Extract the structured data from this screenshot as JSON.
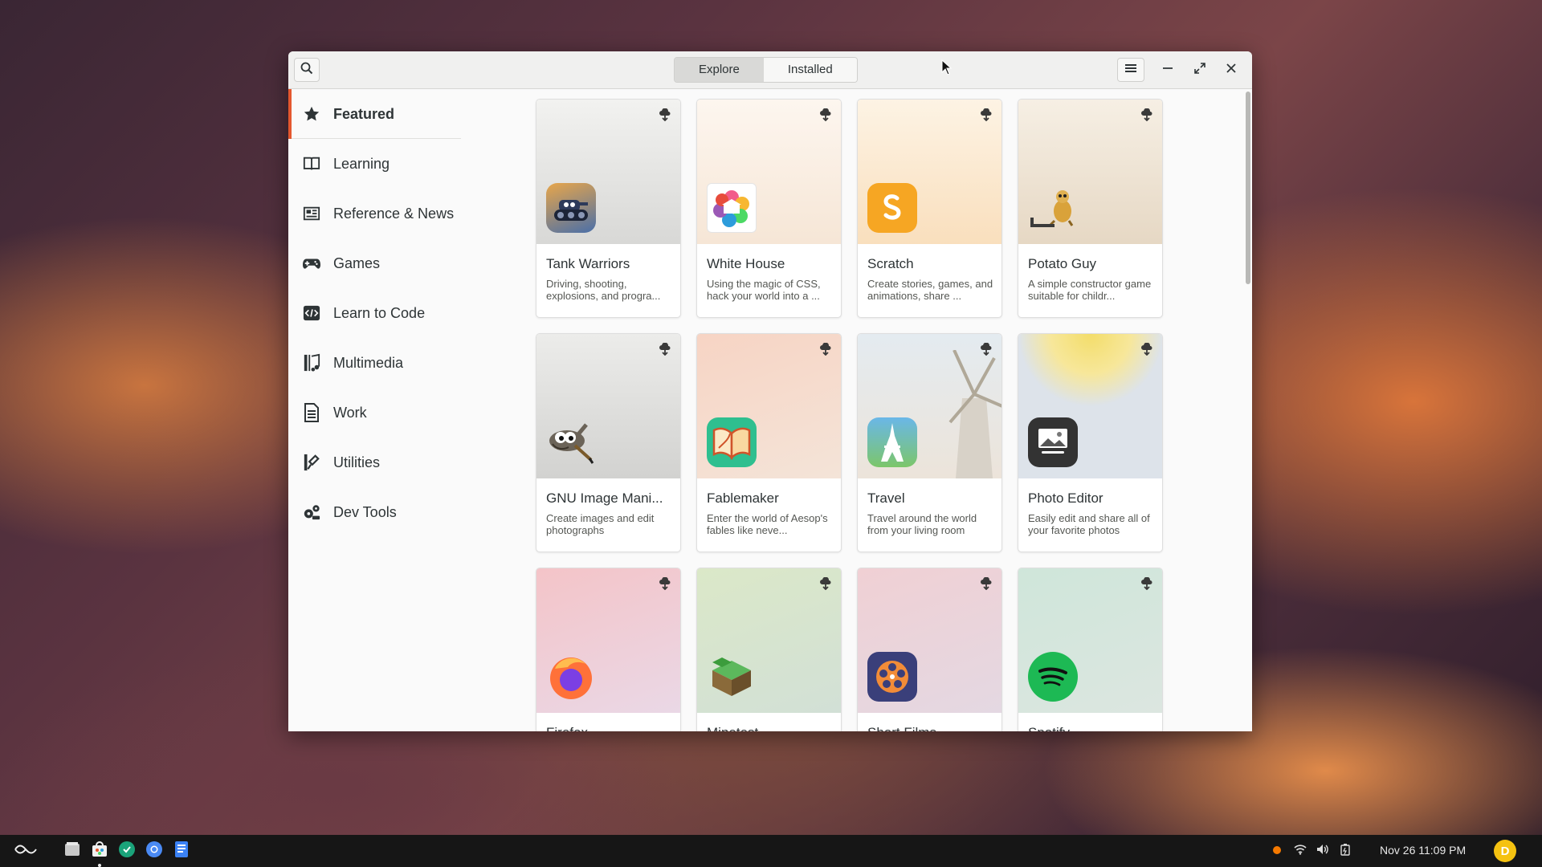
{
  "header": {
    "tabs": [
      {
        "label": "Explore",
        "active": true
      },
      {
        "label": "Installed",
        "active": false
      }
    ],
    "search_icon": "search-icon",
    "menu_icon": "hamburger-menu-icon"
  },
  "sidebar": {
    "items": [
      {
        "label": "Featured",
        "icon": "star-icon",
        "active": true
      },
      {
        "label": "Learning",
        "icon": "book-icon"
      },
      {
        "label": "Reference & News",
        "icon": "newspaper-icon"
      },
      {
        "label": "Games",
        "icon": "gamepad-icon"
      },
      {
        "label": "Learn to Code",
        "icon": "code-icon"
      },
      {
        "label": "Multimedia",
        "icon": "music-icon"
      },
      {
        "label": "Work",
        "icon": "document-icon"
      },
      {
        "label": "Utilities",
        "icon": "tools-icon"
      },
      {
        "label": "Dev Tools",
        "icon": "gears-icon"
      }
    ]
  },
  "apps": [
    {
      "title": "Tank Warriors",
      "desc": "Driving, shooting, explosions, and progra...",
      "icon": "tank-icon"
    },
    {
      "title": "White House",
      "desc": "Using the magic of CSS, hack your world into a ...",
      "icon": "white-house-icon"
    },
    {
      "title": "Scratch",
      "desc": "Create stories, games, and animations, share ...",
      "icon": "scratch-icon"
    },
    {
      "title": "Potato Guy",
      "desc": "A simple constructor game suitable for childr...",
      "icon": "potato-guy-icon"
    },
    {
      "title": "GNU Image Mani...",
      "desc": "Create images and edit photographs",
      "icon": "gimp-icon"
    },
    {
      "title": "Fablemaker",
      "desc": "Enter the world of Aesop's fables like neve...",
      "icon": "fablemaker-icon"
    },
    {
      "title": "Travel",
      "desc": "Travel around the world from your living room",
      "icon": "eiffel-tower-icon"
    },
    {
      "title": "Photo Editor",
      "desc": "Easily edit and share all of your favorite photos",
      "icon": "photo-editor-icon"
    },
    {
      "title": "Firefox",
      "desc": "",
      "icon": "firefox-icon"
    },
    {
      "title": "Minetest",
      "desc": "",
      "icon": "minetest-icon"
    },
    {
      "title": "Short Films",
      "desc": "",
      "icon": "film-reel-icon"
    },
    {
      "title": "Spotify",
      "desc": "",
      "icon": "spotify-icon"
    }
  ],
  "taskbar": {
    "clock": "Nov 26  11:09 PM",
    "avatar_letter": "D",
    "tray_icons": [
      "notification-dot-icon",
      "wifi-icon",
      "volume-icon",
      "battery-icon"
    ],
    "pinned_apps": [
      "files-icon",
      "app-center-icon",
      "app-icon",
      "chromium-icon",
      "document-app-icon"
    ]
  },
  "colors": {
    "accent": "#e4572e",
    "spotify": "#1db954"
  }
}
